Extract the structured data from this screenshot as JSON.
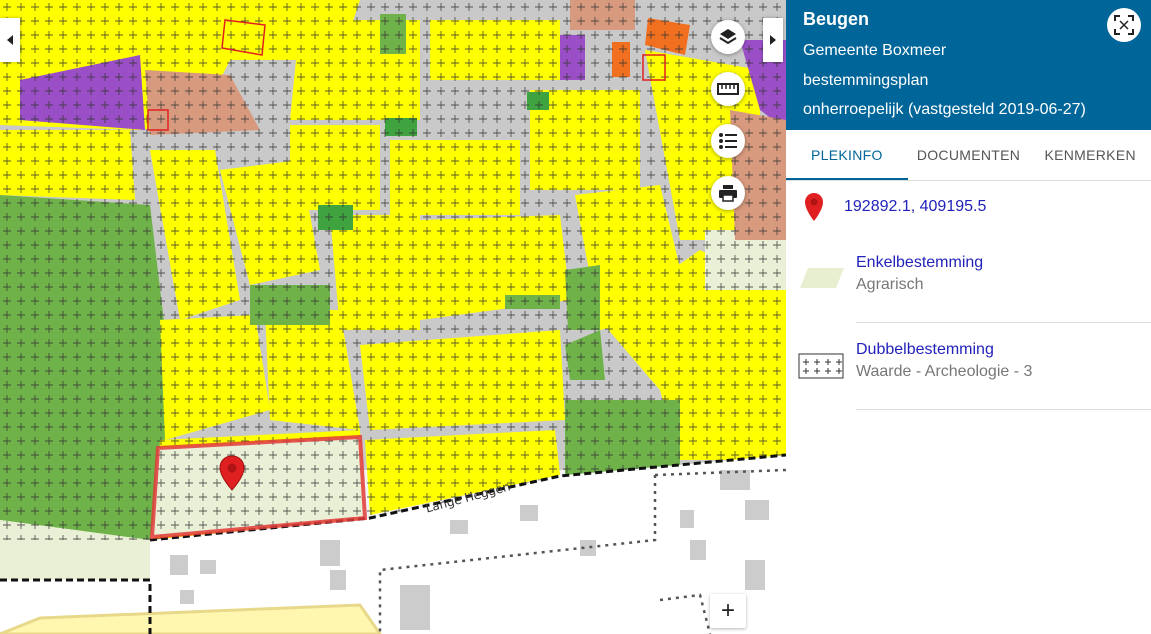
{
  "map": {
    "street_name": "Lange Heggen",
    "zoom_in_label": "+"
  },
  "panel": {
    "title": "Beugen",
    "municipality": "Gemeente Boxmeer",
    "plan_type": "bestemmingsplan",
    "status": "onherroepelijk (vastgesteld 2019-06-27)",
    "tabs": [
      {
        "label": "PLEKINFO",
        "active": true
      },
      {
        "label": "DOCUMENTEN",
        "active": false
      },
      {
        "label": "KENMERKEN",
        "active": false
      }
    ],
    "coordinates": "192892.1, 409195.5",
    "legend": [
      {
        "title": "Enkelbestemming",
        "subtitle": "Agrarisch",
        "symbol": "agrarisch-swatch"
      },
      {
        "title": "Dubbelbestemming",
        "subtitle": "Waarde - Archeologie - 3",
        "symbol": "archeologie-swatch"
      }
    ]
  },
  "colors": {
    "header": "#006699",
    "residential": "#ffff00",
    "green": "#6ab04c",
    "agricultural": "#e8efd0",
    "mixed": "#d89a7e",
    "purple": "#9b4fc7",
    "link": "#2222bb",
    "marker": "#e02020"
  }
}
